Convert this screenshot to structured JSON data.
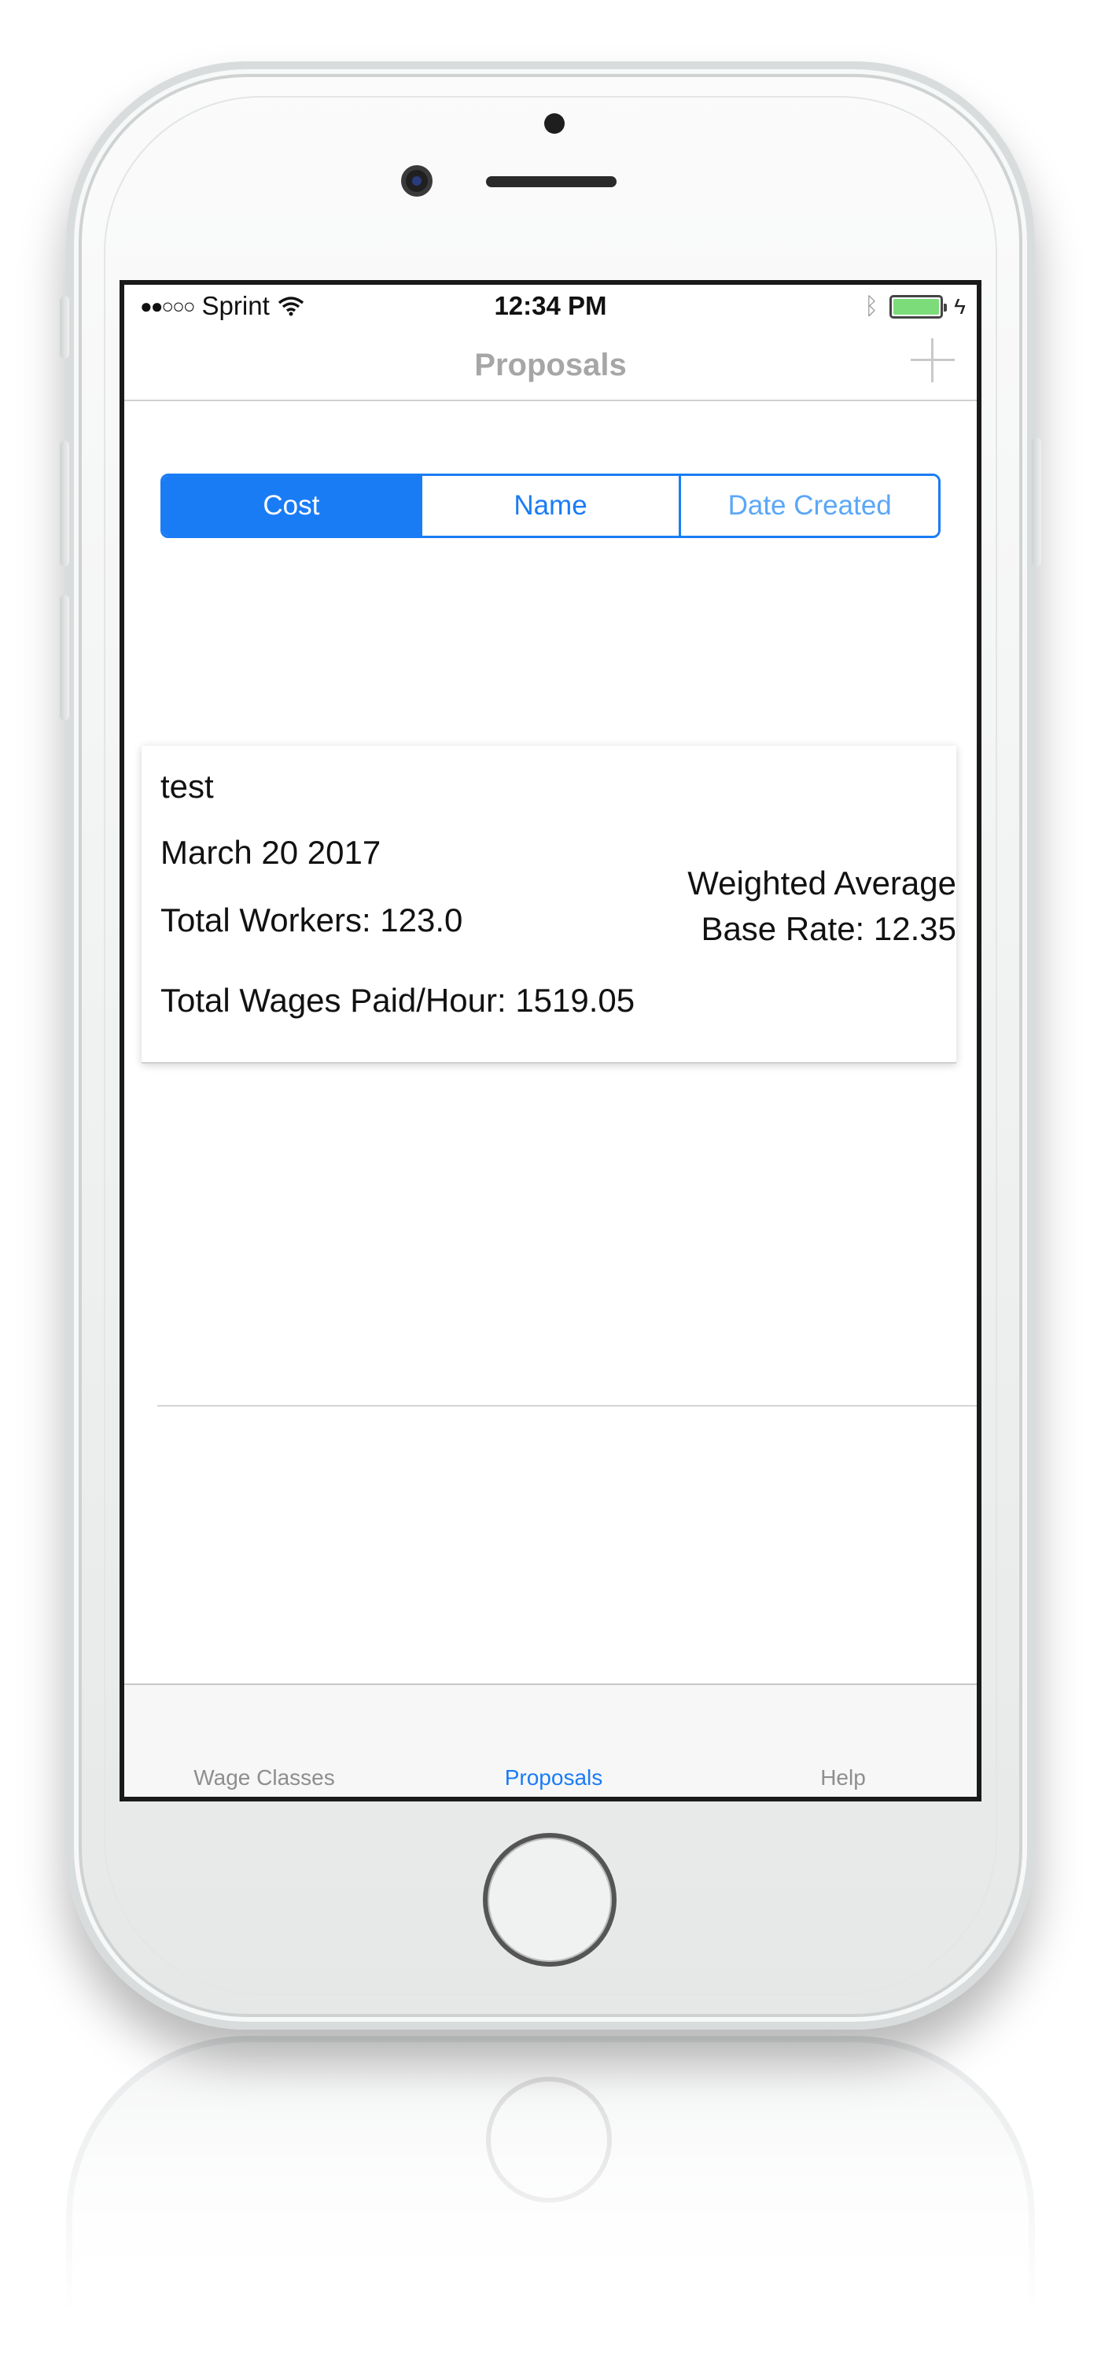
{
  "status_bar": {
    "signal": "●●○○○",
    "carrier": "Sprint",
    "time": "12:34 PM",
    "bluetooth_icon": "bluetooth-icon",
    "battery_icon": "battery-icon",
    "charging_icon": "charging-bolt-icon"
  },
  "nav": {
    "title": "Proposals",
    "add_icon": "plus-icon"
  },
  "sort_segments": [
    {
      "label": "Cost",
      "selected": true
    },
    {
      "label": "Name",
      "selected": false
    },
    {
      "label": "Date Created",
      "selected": false
    }
  ],
  "proposal": {
    "name": "test",
    "date": "March 20 2017",
    "workers": "Total Workers: 123.0",
    "rate_line1": "Weighted Average",
    "rate_line2": "Base Rate: 12.35",
    "wages": "Total Wages Paid/Hour: 1519.05"
  },
  "tabs": [
    {
      "label": "Wage Classes",
      "selected": false
    },
    {
      "label": "Proposals",
      "selected": true
    },
    {
      "label": "Help",
      "selected": false
    }
  ],
  "colors": {
    "accent": "#1a7cf5",
    "battery": "#7ddc7a",
    "nav_title": "#a6a6a6"
  }
}
